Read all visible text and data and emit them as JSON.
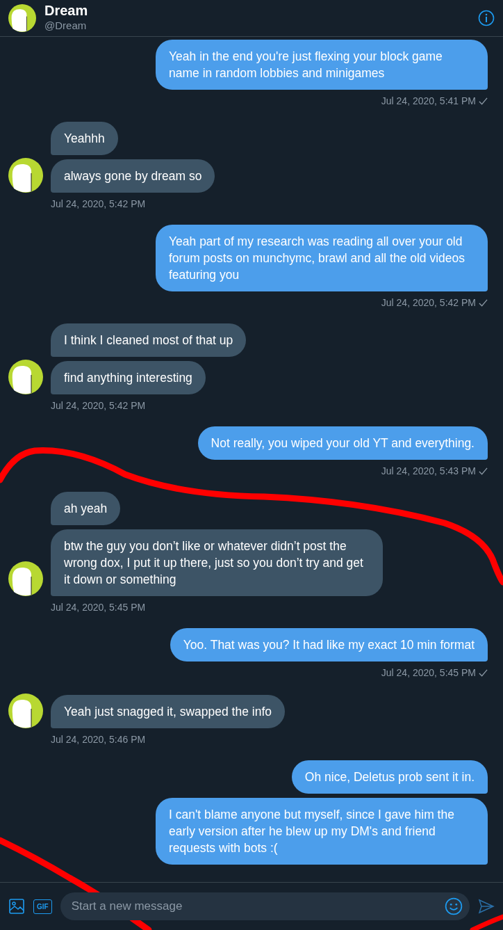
{
  "header": {
    "name": "Dream",
    "handle": "@Dream"
  },
  "groups": [
    {
      "kind": "sent",
      "bubbles": [
        "Yeah in the end you're just flexing your block game name in random lobbies and minigames"
      ],
      "time": "Jul 24, 2020, 5:41 PM",
      "delivered": true
    },
    {
      "kind": "received",
      "bubbles": [
        "Yeahhh",
        "always gone by dream so"
      ],
      "time": "Jul 24, 2020, 5:42 PM"
    },
    {
      "kind": "sent",
      "bubbles": [
        "Yeah part of my research was reading all over your old forum posts on munchymc, brawl and all the old videos featuring you"
      ],
      "time": "Jul 24, 2020, 5:42 PM",
      "delivered": true
    },
    {
      "kind": "received",
      "bubbles": [
        "I think I cleaned most of that up",
        "find anything interesting"
      ],
      "time": "Jul 24, 2020, 5:42 PM"
    },
    {
      "kind": "sent",
      "bubbles": [
        "Not really, you wiped your old YT and everything."
      ],
      "time": "Jul 24, 2020, 5:43 PM",
      "delivered": true
    },
    {
      "kind": "received",
      "bubbles": [
        "ah yeah",
        "btw the guy you don’t like or whatever didn’t post the wrong dox, I put it up there, just so you don’t try and get it down or something"
      ],
      "time": "Jul 24, 2020, 5:45 PM"
    },
    {
      "kind": "sent",
      "bubbles": [
        "Yoo. That was you? It had like my exact 10 min format"
      ],
      "time": "Jul 24, 2020, 5:45 PM",
      "delivered": true
    },
    {
      "kind": "received",
      "bubbles": [
        "Yeah just snagged it, swapped the info"
      ],
      "time": "Jul 24, 2020, 5:46 PM"
    },
    {
      "kind": "sent",
      "bubbles": [
        "Oh nice, Deletus prob sent it in.",
        "I can't blame anyone but myself, since I gave him the early version after he blew up my DM's and friend requests with bots :("
      ]
    }
  ],
  "composer": {
    "gif_label": "GIF",
    "placeholder": "Start a new message"
  }
}
